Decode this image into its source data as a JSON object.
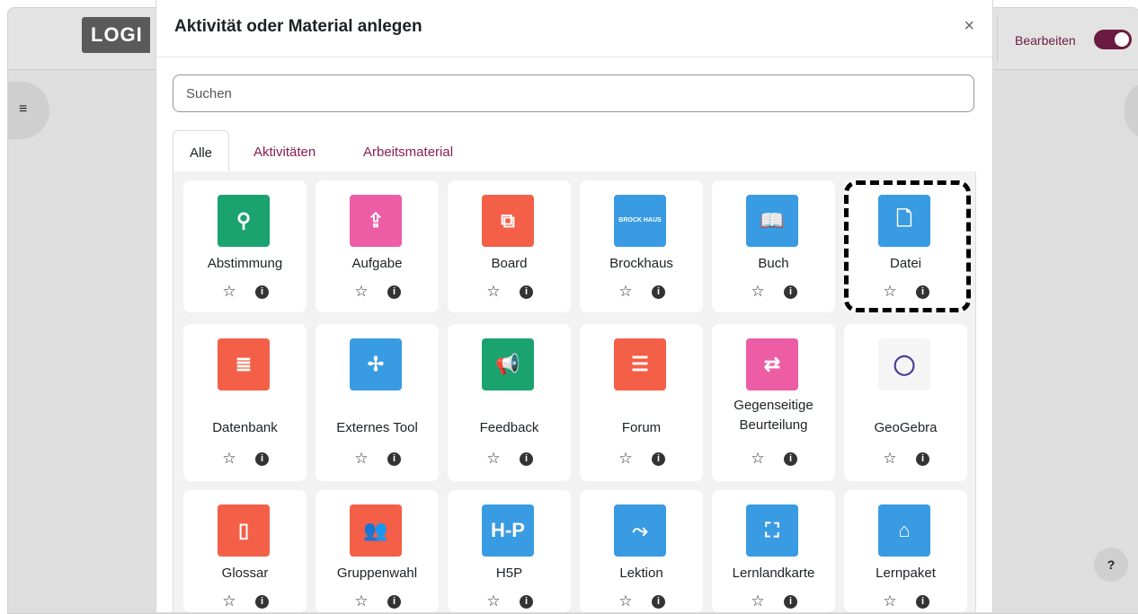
{
  "background": {
    "logo": "LOGI",
    "edit_label": "Bearbeiten",
    "help": "?",
    "drawer_icon": "≡"
  },
  "modal": {
    "title": "Aktivität oder Material anlegen",
    "close": "×",
    "search_placeholder": "Suchen",
    "tabs": [
      {
        "label": "Alle",
        "active": true
      },
      {
        "label": "Aktivitäten",
        "active": false
      },
      {
        "label": "Arbeitsmaterial",
        "active": false
      }
    ]
  },
  "items": [
    {
      "name": "Abstimmung",
      "icon": "choice-icon",
      "glyph": "⚲",
      "color": "#1aa36f"
    },
    {
      "name": "Aufgabe",
      "icon": "assignment-icon",
      "glyph": "⇪",
      "color": "#ec5da5"
    },
    {
      "name": "Board",
      "icon": "board-icon",
      "glyph": "⧉",
      "color": "#f45f48"
    },
    {
      "name": "Brockhaus",
      "icon": "brockhaus-icon",
      "glyph": "BROCK HAUS",
      "color": "#399be2"
    },
    {
      "name": "Buch",
      "icon": "book-icon",
      "glyph": "📖",
      "color": "#399be2"
    },
    {
      "name": "Datei",
      "icon": "file-icon",
      "glyph": "🗋",
      "color": "#399be2"
    },
    {
      "name": "Datenbank",
      "icon": "database-icon",
      "glyph": "≣",
      "color": "#f45f48"
    },
    {
      "name": "Externes Tool",
      "icon": "puzzle-icon",
      "glyph": "✢",
      "color": "#399be2"
    },
    {
      "name": "Feedback",
      "icon": "megaphone-icon",
      "glyph": "📢",
      "color": "#1aa36f"
    },
    {
      "name": "Forum",
      "icon": "forum-icon",
      "glyph": "☰",
      "color": "#f45f48"
    },
    {
      "name": "Gegenseitige Beurteilung",
      "icon": "workshop-icon",
      "glyph": "⇄",
      "color": "#ec5da5"
    },
    {
      "name": "GeoGebra",
      "icon": "geogebra-icon",
      "glyph": "◯",
      "color": "#f5f5f5"
    },
    {
      "name": "Glossar",
      "icon": "glossary-icon",
      "glyph": "▯",
      "color": "#f45f48"
    },
    {
      "name": "Gruppenwahl",
      "icon": "group-choice-icon",
      "glyph": "👥",
      "color": "#f45f48"
    },
    {
      "name": "H5P",
      "icon": "h5p-icon",
      "glyph": "H-P",
      "color": "#399be2"
    },
    {
      "name": "Lektion",
      "icon": "lesson-icon",
      "glyph": "⤳",
      "color": "#399be2"
    },
    {
      "name": "Lernlandkarte",
      "icon": "map-icon",
      "glyph": "⛶",
      "color": "#399be2"
    },
    {
      "name": "Lernpaket",
      "icon": "package-icon",
      "glyph": "⌂",
      "color": "#399be2"
    }
  ],
  "card_actions": {
    "star": "☆",
    "info": "i"
  }
}
